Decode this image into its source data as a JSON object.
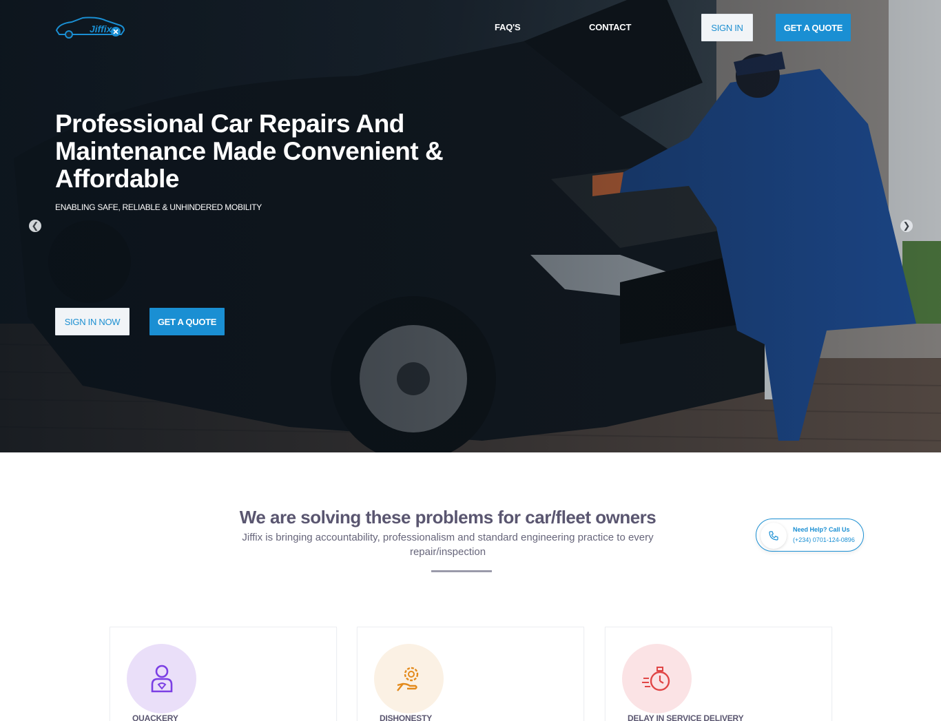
{
  "nav": {
    "logo_text": "Jiffix",
    "links": [
      "FAQ'S",
      "CONTACT"
    ],
    "sign_in": "SIGN IN",
    "get_quote": "GET A QUOTE"
  },
  "hero": {
    "title": "Professional Car Repairs And Maintenance Made Convenient & Affordable",
    "subtitle": "ENABLING SAFE, RELIABLE & UNHINDERED MOBILITY",
    "sign_in_now": "SIGN IN NOW",
    "get_quote": "GET A QUOTE",
    "prev_icon": "chevron-left-icon",
    "next_icon": "chevron-right-icon"
  },
  "problems": {
    "title": "We are solving these problems for car/fleet owners",
    "description": "Jiffix is bringing accountability, professionalism and standard engineering practice to every repair/inspection",
    "cards": [
      {
        "label": "QUACKERY",
        "icon": "mechanic-person-icon",
        "color": "#7b3fe4",
        "bg": "#eadff9"
      },
      {
        "label": "DISHONESTY",
        "icon": "gear-hand-icon",
        "color": "#e38a1b",
        "bg": "#fbf1e4"
      },
      {
        "label": "DELAY IN SERVICE DELIVERY",
        "icon": "stopwatch-icon",
        "color": "#e04545",
        "bg": "#fbe3e5"
      }
    ]
  },
  "help": {
    "title": "Need Help? Call Us",
    "phone": "(+234) 0701-124-0896",
    "icon": "phone-icon"
  },
  "colors": {
    "accent": "#1a8fd3",
    "heading": "#5a5670"
  }
}
